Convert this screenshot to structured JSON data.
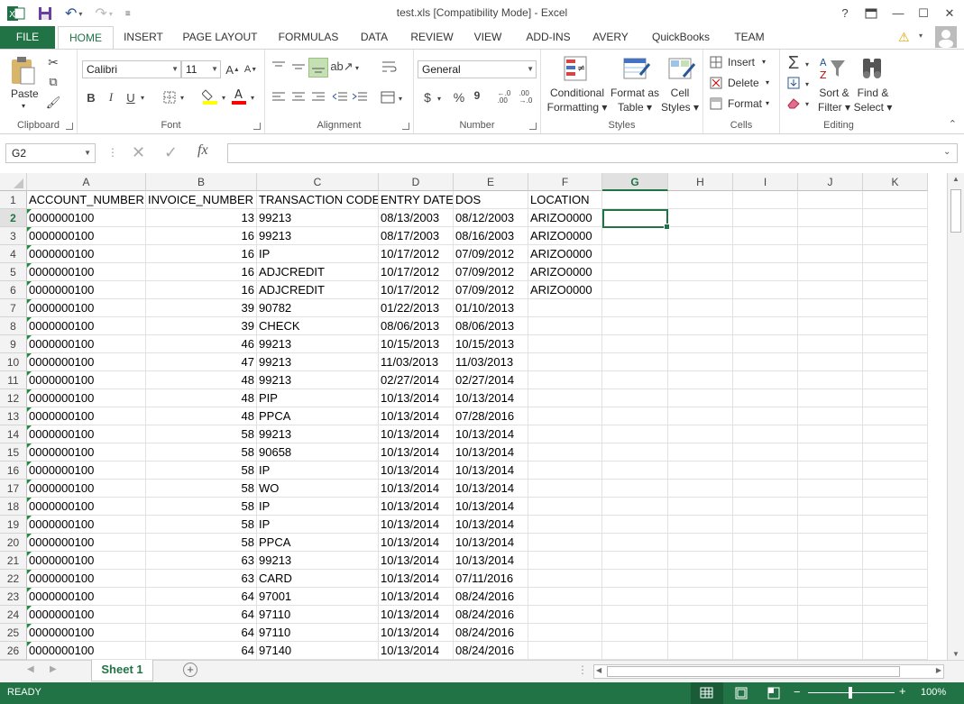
{
  "window": {
    "title": "test.xls  [Compatibility Mode] - Excel",
    "help": "?",
    "buttons": [
      "?",
      "▭",
      "—",
      "☐",
      "✕"
    ]
  },
  "ribbon_tabs": [
    "FILE",
    "HOME",
    "INSERT",
    "PAGE LAYOUT",
    "FORMULAS",
    "DATA",
    "REVIEW",
    "VIEW",
    "ADD-INS",
    "AVERY",
    "QuickBooks",
    "TEAM"
  ],
  "active_tab": "HOME",
  "ribbon": {
    "clipboard": {
      "label": "Clipboard",
      "paste": "Paste"
    },
    "font": {
      "label": "Font",
      "name": "Calibri",
      "size": "11",
      "bold": "B",
      "italic": "I",
      "underline": "U",
      "fill_color": "#ffff00",
      "font_color": "#ff0000"
    },
    "alignment": {
      "label": "Alignment"
    },
    "number": {
      "label": "Number",
      "format": "General",
      "currency": "$",
      "percent": "%",
      "comma": "9"
    },
    "styles": {
      "label": "Styles",
      "conditional": [
        "Conditional",
        "Formatting"
      ],
      "format_table": [
        "Format as",
        "Table"
      ],
      "cell_styles": [
        "Cell",
        "Styles"
      ]
    },
    "cells": {
      "label": "Cells",
      "insert": "Insert",
      "delete": "Delete",
      "format": "Format"
    },
    "editing": {
      "label": "Editing",
      "sort": [
        "Sort &",
        "Filter"
      ],
      "find": [
        "Find &",
        "Select"
      ]
    }
  },
  "formula_bar": {
    "name_box": "G2",
    "fx": "fx",
    "value": ""
  },
  "sheet": {
    "columns": [
      "A",
      "B",
      "C",
      "D",
      "E",
      "F",
      "G",
      "H",
      "I",
      "J",
      "K"
    ],
    "selected_column": "G",
    "selected_row": 2,
    "header_row": [
      "ACCOUNT_NUMBER",
      "INVOICE_NUMBER",
      "TRANSACTION CODE",
      "ENTRY DATE",
      "DOS",
      "LOCATION"
    ],
    "rows": [
      [
        "0000000100",
        "13",
        "99213",
        "08/13/2003",
        "08/12/2003",
        "ARIZO0000"
      ],
      [
        "0000000100",
        "16",
        "99213",
        "08/17/2003",
        "08/16/2003",
        "ARIZO0000"
      ],
      [
        "0000000100",
        "16",
        "IP",
        "10/17/2012",
        "07/09/2012",
        "ARIZO0000"
      ],
      [
        "0000000100",
        "16",
        "ADJCREDIT",
        "10/17/2012",
        "07/09/2012",
        "ARIZO0000"
      ],
      [
        "0000000100",
        "16",
        "ADJCREDIT",
        "10/17/2012",
        "07/09/2012",
        "ARIZO0000"
      ],
      [
        "0000000100",
        "39",
        "90782",
        "01/22/2013",
        "01/10/2013",
        ""
      ],
      [
        "0000000100",
        "39",
        "CHECK",
        "08/06/2013",
        "08/06/2013",
        ""
      ],
      [
        "0000000100",
        "46",
        "99213",
        "10/15/2013",
        "10/15/2013",
        ""
      ],
      [
        "0000000100",
        "47",
        "99213",
        "11/03/2013",
        "11/03/2013",
        ""
      ],
      [
        "0000000100",
        "48",
        "99213",
        "02/27/2014",
        "02/27/2014",
        ""
      ],
      [
        "0000000100",
        "48",
        "PIP",
        "10/13/2014",
        "10/13/2014",
        ""
      ],
      [
        "0000000100",
        "48",
        "PPCA",
        "10/13/2014",
        "07/28/2016",
        ""
      ],
      [
        "0000000100",
        "58",
        "99213",
        "10/13/2014",
        "10/13/2014",
        ""
      ],
      [
        "0000000100",
        "58",
        "90658",
        "10/13/2014",
        "10/13/2014",
        ""
      ],
      [
        "0000000100",
        "58",
        "IP",
        "10/13/2014",
        "10/13/2014",
        ""
      ],
      [
        "0000000100",
        "58",
        "WO",
        "10/13/2014",
        "10/13/2014",
        ""
      ],
      [
        "0000000100",
        "58",
        "IP",
        "10/13/2014",
        "10/13/2014",
        ""
      ],
      [
        "0000000100",
        "58",
        "IP",
        "10/13/2014",
        "10/13/2014",
        ""
      ],
      [
        "0000000100",
        "58",
        "PPCA",
        "10/13/2014",
        "10/13/2014",
        ""
      ],
      [
        "0000000100",
        "63",
        "99213",
        "10/13/2014",
        "10/13/2014",
        ""
      ],
      [
        "0000000100",
        "63",
        "CARD",
        "10/13/2014",
        "07/11/2016",
        ""
      ],
      [
        "0000000100",
        "64",
        "97001",
        "10/13/2014",
        "08/24/2016",
        ""
      ],
      [
        "0000000100",
        "64",
        "97110",
        "10/13/2014",
        "08/24/2016",
        ""
      ],
      [
        "0000000100",
        "64",
        "97110",
        "10/13/2014",
        "08/24/2016",
        ""
      ],
      [
        "0000000100",
        "64",
        "97140",
        "10/13/2014",
        "08/24/2016",
        ""
      ]
    ]
  },
  "sheet_tabs": [
    "Sheet 1"
  ],
  "status": {
    "text": "READY",
    "zoom": "100%"
  },
  "colors": {
    "accent": "#217346",
    "text_marker": "#1e8e3e"
  }
}
